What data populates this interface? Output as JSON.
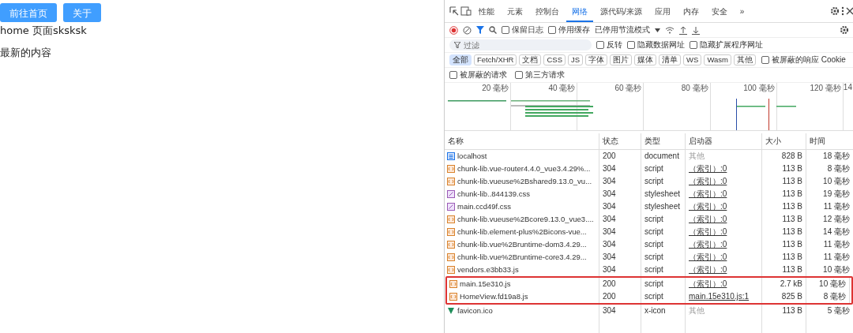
{
  "page": {
    "buttons": [
      {
        "label": "前往首页"
      },
      {
        "label": "关于"
      }
    ],
    "texts": [
      "home 页面sksksk",
      "最新的内容"
    ]
  },
  "devtools": {
    "tabs": [
      {
        "label": "性能",
        "selected": false
      },
      {
        "label": "元素",
        "selected": false
      },
      {
        "label": "控制台",
        "selected": false
      },
      {
        "label": "网络",
        "selected": true
      },
      {
        "label": "源代码/来源",
        "selected": false
      },
      {
        "label": "应用",
        "selected": false
      },
      {
        "label": "内存",
        "selected": false
      },
      {
        "label": "安全",
        "selected": false
      },
      {
        "label": "»",
        "selected": false
      }
    ],
    "toolbar": {
      "recording": true,
      "filter_active": true,
      "checkboxes": [
        {
          "label": "保留日志",
          "checked": false
        },
        {
          "label": "停用缓存",
          "checked": false
        }
      ],
      "throttle": "已停用节流模式"
    },
    "filter": {
      "placeholder": "过滤",
      "checkboxes": [
        {
          "label": "反转",
          "checked": false
        },
        {
          "label": "隐藏数据网址",
          "checked": false
        },
        {
          "label": "隐藏扩展程序网址",
          "checked": false
        }
      ]
    },
    "type_chips": [
      {
        "label": "全部",
        "selected": true
      },
      {
        "label": "Fetch/XHR",
        "selected": false
      },
      {
        "label": "文档",
        "selected": false
      },
      {
        "label": "CSS",
        "selected": false
      },
      {
        "label": "JS",
        "selected": false
      },
      {
        "label": "字体",
        "selected": false
      },
      {
        "label": "图片",
        "selected": false
      },
      {
        "label": "媒体",
        "selected": false
      },
      {
        "label": "清单",
        "selected": false
      },
      {
        "label": "WS",
        "selected": false
      },
      {
        "label": "Wasm",
        "selected": false
      },
      {
        "label": "其他",
        "selected": false
      }
    ],
    "blocked_cookies": {
      "label": "被屏蔽的响应 Cookie",
      "checked": false
    },
    "request_checkboxes": [
      {
        "label": "被屏蔽的请求",
        "checked": false
      },
      {
        "label": "第三方请求",
        "checked": false
      }
    ],
    "overview": {
      "ticks": [
        "20 毫秒",
        "40 毫秒",
        "60 毫秒",
        "80 毫秒",
        "100 毫秒",
        "120 毫秒",
        "14"
      ]
    },
    "table": {
      "columns": [
        "名称",
        "状态",
        "类型",
        "启动器",
        "大小",
        "时间"
      ],
      "rows": [
        {
          "kind": "document",
          "name": "localhost",
          "status": "200",
          "type": "document",
          "initiator": "其他",
          "initiator_link": false,
          "size": "828 B",
          "time": "18 毫秒",
          "highlighted": false
        },
        {
          "kind": "script",
          "name": "chunk-lib.vue-router4.4.0_vue3.4.29%...",
          "status": "304",
          "type": "script",
          "initiator": "（索引）:0",
          "initiator_link": true,
          "size": "113 B",
          "time": "8 毫秒",
          "highlighted": false
        },
        {
          "kind": "script",
          "name": "chunk-lib.vueuse%2Bshared9.13.0_vu...",
          "status": "304",
          "type": "script",
          "initiator": "（索引）:0",
          "initiator_link": true,
          "size": "113 B",
          "time": "10 毫秒",
          "highlighted": false
        },
        {
          "kind": "stylesheet",
          "name": "chunk-lib..844139.css",
          "status": "304",
          "type": "stylesheet",
          "initiator": "（索引）:0",
          "initiator_link": true,
          "size": "113 B",
          "time": "19 毫秒",
          "highlighted": false
        },
        {
          "kind": "stylesheet",
          "name": "main.ccd49f.css",
          "status": "304",
          "type": "stylesheet",
          "initiator": "（索引）:0",
          "initiator_link": true,
          "size": "113 B",
          "time": "11 毫秒",
          "highlighted": false
        },
        {
          "kind": "script",
          "name": "chunk-lib.vueuse%2Bcore9.13.0_vue3....",
          "status": "304",
          "type": "script",
          "initiator": "（索引）:0",
          "initiator_link": true,
          "size": "113 B",
          "time": "12 毫秒",
          "highlighted": false
        },
        {
          "kind": "script",
          "name": "chunk-lib.element-plus%2Bicons-vue...",
          "status": "304",
          "type": "script",
          "initiator": "（索引）:0",
          "initiator_link": true,
          "size": "113 B",
          "time": "14 毫秒",
          "highlighted": false
        },
        {
          "kind": "script",
          "name": "chunk-lib.vue%2Bruntime-dom3.4.29...",
          "status": "304",
          "type": "script",
          "initiator": "（索引）:0",
          "initiator_link": true,
          "size": "113 B",
          "time": "11 毫秒",
          "highlighted": false
        },
        {
          "kind": "script",
          "name": "chunk-lib.vue%2Bruntime-core3.4.29...",
          "status": "304",
          "type": "script",
          "initiator": "（索引）:0",
          "initiator_link": true,
          "size": "113 B",
          "time": "11 毫秒",
          "highlighted": false
        },
        {
          "kind": "script",
          "name": "vendors.e3bb33.js",
          "status": "304",
          "type": "script",
          "initiator": "（索引）:0",
          "initiator_link": true,
          "size": "113 B",
          "time": "10 毫秒",
          "highlighted": false
        },
        {
          "kind": "script",
          "name": "main.15e310.js",
          "status": "200",
          "type": "script",
          "initiator": "（索引）:0",
          "initiator_link": true,
          "size": "2.7 kB",
          "time": "10 毫秒",
          "highlighted": true
        },
        {
          "kind": "script",
          "name": "HomeView.fd19a8.js",
          "status": "200",
          "type": "script",
          "initiator": "main.15e310.js:1",
          "initiator_link": true,
          "size": "825 B",
          "time": "8 毫秒",
          "highlighted": true
        },
        {
          "kind": "favicon",
          "name": "favicon.ico",
          "status": "304",
          "type": "x-icon",
          "initiator": "其他",
          "initiator_link": false,
          "size": "113 B",
          "time": "5 毫秒",
          "highlighted": false
        }
      ]
    }
  }
}
